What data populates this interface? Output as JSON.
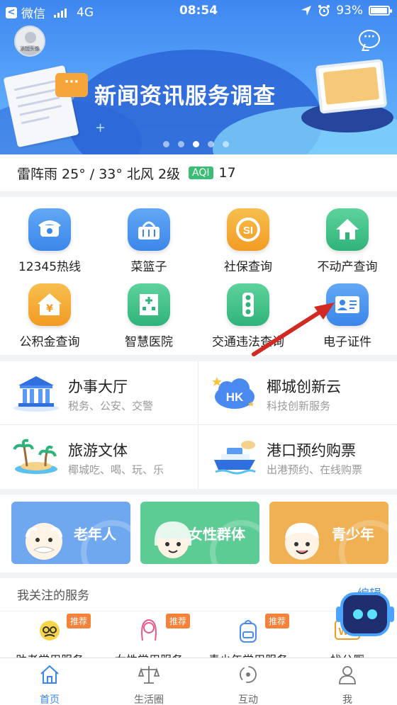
{
  "status_bar": {
    "carrier": "微信",
    "network": "4G",
    "time": "08:54",
    "battery": "93%"
  },
  "banner": {
    "title": "新闻资讯服务调查",
    "avatar_tag": "添加头像",
    "slides": 5,
    "active_slide": 3
  },
  "weather": {
    "text": "雷阵雨 25° / 33° 北风 2级",
    "aqi_label": "AQI",
    "aqi_value": "17"
  },
  "quick_grid": [
    {
      "label": "12345热线",
      "icon": "phone-icon",
      "color": "#3b86ea"
    },
    {
      "label": "菜篮子",
      "icon": "basket-icon",
      "color": "#3b86ea"
    },
    {
      "label": "社保查询",
      "icon": "social-security-icon",
      "color": "#f29b24"
    },
    {
      "label": "不动产查询",
      "icon": "house-icon",
      "color": "#2fb37a"
    },
    {
      "label": "公积金查询",
      "icon": "fund-house-icon",
      "color": "#f29b24"
    },
    {
      "label": "智慧医院",
      "icon": "hospital-icon",
      "color": "#2fb37a"
    },
    {
      "label": "交通违法查询",
      "icon": "traffic-light-icon",
      "color": "#2fb37a"
    },
    {
      "label": "电子证件",
      "icon": "id-card-icon",
      "color": "#3b86ea"
    }
  ],
  "services": [
    {
      "title": "办事大厅",
      "subtitle": "税务、公安、交警",
      "icon": "government-hall-icon"
    },
    {
      "title": "椰城创新云",
      "subtitle": "科技创新服务",
      "icon": "hk-cloud-icon"
    },
    {
      "title": "旅游文体",
      "subtitle": "椰城吃、喝、玩、乐",
      "icon": "palm-island-icon"
    },
    {
      "title": "港口预约购票",
      "subtitle": "出港预约、在线购票",
      "icon": "ship-icon"
    }
  ],
  "groups": [
    {
      "label": "老年人",
      "color": "#6fa8ee"
    },
    {
      "label": "女性群体",
      "color": "#5ccb94"
    },
    {
      "label": "青少年",
      "color": "#f0b155"
    }
  ],
  "followed": {
    "title": "我关注的服务",
    "edit_label": "编辑",
    "items": [
      {
        "label": "助老常用服务",
        "badge": "推荐",
        "icon": "elder-icon"
      },
      {
        "label": "女性常用服务",
        "badge": "推荐",
        "icon": "woman-icon"
      },
      {
        "label": "青少年常用服务",
        "badge": "推荐",
        "icon": "backpack-icon"
      },
      {
        "label": "找公厕",
        "badge": "",
        "icon": "wc-icon"
      }
    ]
  },
  "tabbar": [
    {
      "label": "首页",
      "icon": "home-icon",
      "active": true
    },
    {
      "label": "生活圈",
      "icon": "scale-icon",
      "active": false
    },
    {
      "label": "互动",
      "icon": "interaction-icon",
      "active": false
    },
    {
      "label": "我",
      "icon": "user-icon",
      "active": false
    }
  ]
}
